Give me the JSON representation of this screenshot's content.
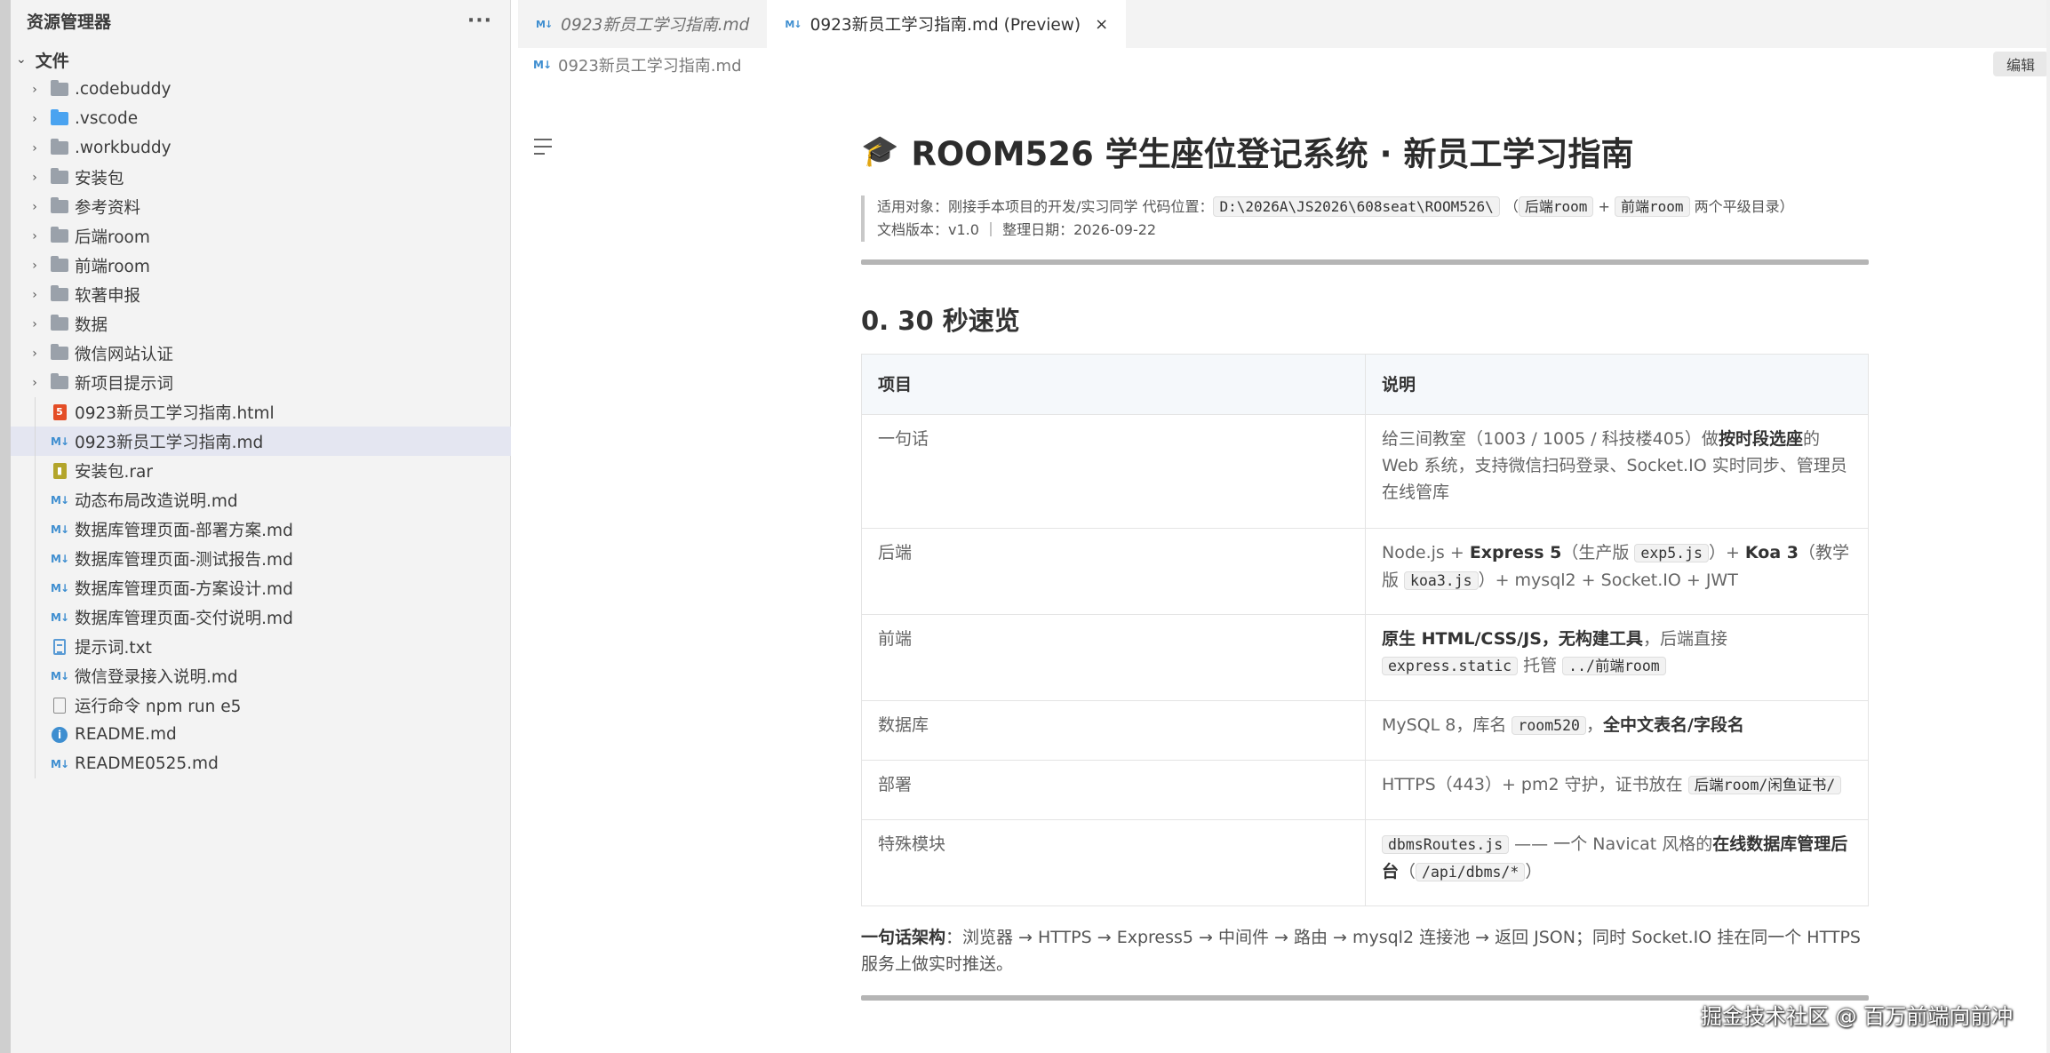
{
  "sidebar": {
    "title": "资源管理器",
    "more": "···",
    "section": "文件",
    "items": [
      {
        "label": ".codebuddy",
        "type": "folder"
      },
      {
        "label": ".vscode",
        "type": "folder-blue"
      },
      {
        "label": ".workbuddy",
        "type": "folder"
      },
      {
        "label": "安装包",
        "type": "folder"
      },
      {
        "label": "参考资料",
        "type": "folder"
      },
      {
        "label": "后端room",
        "type": "folder"
      },
      {
        "label": "前端room",
        "type": "folder"
      },
      {
        "label": "软著申报",
        "type": "folder"
      },
      {
        "label": "数据",
        "type": "folder"
      },
      {
        "label": "微信网站认证",
        "type": "folder"
      },
      {
        "label": "新项目提示词",
        "type": "folder"
      },
      {
        "label": "0923新员工学习指南.html",
        "type": "html"
      },
      {
        "label": "0923新员工学习指南.md",
        "type": "md",
        "selected": true
      },
      {
        "label": "安装包.rar",
        "type": "rar"
      },
      {
        "label": "动态布局改造说明.md",
        "type": "md"
      },
      {
        "label": "数据库管理页面-部署方案.md",
        "type": "md"
      },
      {
        "label": "数据库管理页面-测试报告.md",
        "type": "md"
      },
      {
        "label": "数据库管理页面-方案设计.md",
        "type": "md"
      },
      {
        "label": "数据库管理页面-交付说明.md",
        "type": "md"
      },
      {
        "label": "提示词.txt",
        "type": "txt"
      },
      {
        "label": "微信登录接入说明.md",
        "type": "md"
      },
      {
        "label": "运行命令 npm run e5",
        "type": "file"
      },
      {
        "label": "README.md",
        "type": "info"
      },
      {
        "label": "README0525.md",
        "type": "md"
      }
    ]
  },
  "tabs": [
    {
      "label": "0923新员工学习指南.md",
      "active": false
    },
    {
      "label": "0923新员工学习指南.md (Preview)",
      "active": true,
      "close": "×"
    }
  ],
  "breadcrumb": "0923新员工学习指南.md",
  "edit_button": "编辑",
  "doc": {
    "title_icon": "🎓",
    "title": "ROOM526 学生座位登记系统 · 新员工学习指南",
    "quote": {
      "audience_prefix": "适用对象：刚接手本项目的开发/实习同学 代码位置：",
      "path": "D:\\2026A\\JS2026\\608seat\\ROOM526\\",
      "open_paren": "（",
      "backend_dir": "后端room",
      "plus": "+",
      "frontend_dir": "前端room",
      "suffix": "两个平级目录）",
      "version_line": "文档版本：v1.0 ｜ 整理日期：2026-09-22"
    },
    "section_heading": "0. 30 秒速览",
    "table": {
      "headers": [
        "项目",
        "说明"
      ],
      "rows": [
        {
          "key": "一句话",
          "p1": "给三间教室（1003 / 1005 / 科技楼405）做",
          "b1": "按时段选座",
          "p2": "的 Web 系统，支持微信扫码登录、Socket.IO 实时同步、管理员在线管库"
        },
        {
          "key": "后端",
          "p1": "Node.js + ",
          "b1": "Express 5",
          "p2": "（生产版 ",
          "c1": "exp5.js",
          "p3": "）+ ",
          "b2": "Koa 3",
          "p4": "（教学版 ",
          "c2": "koa3.js",
          "p5": "）+ mysql2 + Socket.IO + JWT"
        },
        {
          "key": "前端",
          "b1": "原生 HTML/CSS/JS，无构建工具",
          "p1": "，后端直接 ",
          "c1": "express.static",
          "p2": " 托管 ",
          "c2": "../前端room"
        },
        {
          "key": "数据库",
          "p1": "MySQL 8，库名 ",
          "c1": "room520",
          "p2": "，",
          "b1": "全中文表名/字段名"
        },
        {
          "key": "部署",
          "p1": "HTTPS（443）+ pm2 守护，证书放在 ",
          "c1": "后端room/闲鱼证书/"
        },
        {
          "key": "特殊模块",
          "c1": "dbmsRoutes.js",
          "p1": " —— 一个 Navicat 风格的",
          "b1": "在线数据库管理后台",
          "p2": "（",
          "c2": "/api/dbms/*",
          "p3": "）"
        }
      ]
    },
    "summary": {
      "bold": "一句话架构",
      "text": "：浏览器 → HTTPS → Express5 → 中间件 → 路由 → mysql2 连接池 → 返回 JSON；同时 Socket.IO 挂在同一个 HTTPS 服务上做实时推送。"
    }
  },
  "watermark": "掘金技术社区 @ 百万前端向前冲"
}
